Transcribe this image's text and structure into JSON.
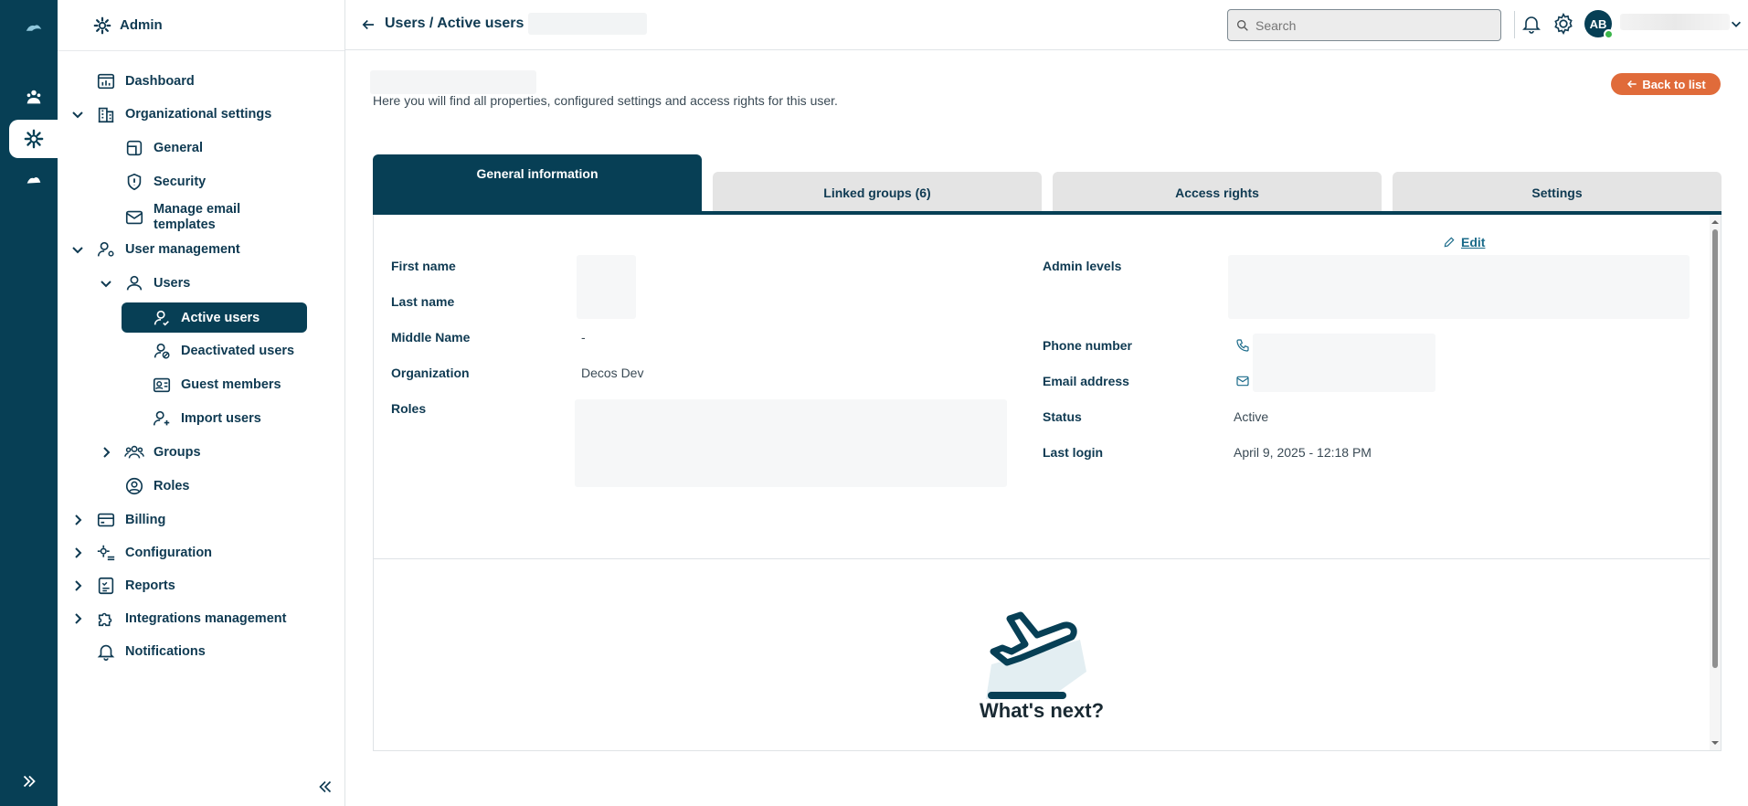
{
  "sidebar": {
    "header_title": "Admin",
    "items": {
      "dashboard": "Dashboard",
      "org_settings": "Organizational settings",
      "general": "General",
      "security": "Security",
      "manage_email_1": "Manage email",
      "manage_email_2": "templates",
      "user_management": "User management",
      "users": "Users",
      "active_users": "Active users",
      "deactivated_users": "Deactivated users",
      "guest_members": "Guest members",
      "import_users": "Import users",
      "groups": "Groups",
      "roles": "Roles",
      "billing": "Billing",
      "configuration": "Configuration",
      "reports": "Reports",
      "integrations": "Integrations management",
      "notifications": "Notifications"
    }
  },
  "topbar": {
    "breadcrumb": "Users / Active users /",
    "search_placeholder": "Search",
    "avatar_initials": "AB"
  },
  "main": {
    "subtitle": "Here you will find all properties, configured settings and access rights for this user.",
    "back_to_list": "Back to list",
    "tabs": [
      "General information",
      "Linked groups (6)",
      "Access rights",
      "Settings"
    ],
    "edit_label": "Edit",
    "fields_left": {
      "first_name": "First name",
      "last_name": "Last name",
      "middle_name": "Middle Name",
      "middle_name_value": "-",
      "organization": "Organization",
      "organization_value": "Decos Dev",
      "roles": "Roles"
    },
    "fields_right": {
      "admin_levels": "Admin levels",
      "phone_number": "Phone number",
      "email_address": "Email address",
      "status": "Status",
      "status_value": "Active",
      "last_login": "Last login",
      "last_login_value": "April 9, 2025 - 12:18 PM"
    },
    "whats_next": "What's next?"
  },
  "colors": {
    "primary": "#073f55",
    "accent": "#e06b3a",
    "online": "#3bb54a"
  }
}
